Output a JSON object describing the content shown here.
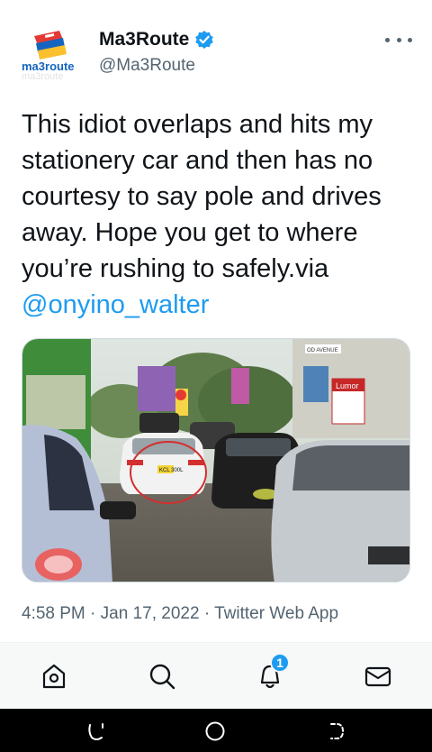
{
  "author": {
    "display_name": "Ma3Route",
    "handle": "@Ma3Route",
    "avatar_text": "ma3route",
    "verified": true
  },
  "tweet": {
    "text": "This idiot overlaps and hits my stationery car and then has no courtesy to say pole and drives away. Hope you get to where you’re rushing to safely.via ",
    "mention": "@onyino_walter",
    "time": "4:58 PM",
    "separator": "·",
    "date": "Jan 17, 2022",
    "source": "Twitter Web App"
  },
  "media": {
    "description_icons": "photo",
    "sign_text": "Lumor",
    "road_sign": "OD AVENUE",
    "plate_text": "KCL 300L"
  },
  "tabbar": {
    "items": [
      {
        "icon": "home-icon"
      },
      {
        "icon": "search-icon"
      },
      {
        "icon": "bell-icon"
      },
      {
        "icon": "mail-icon"
      }
    ],
    "notification_count": "1"
  },
  "colors": {
    "accent": "#1d9bf0",
    "text": "#0f1419",
    "secondary": "#536471"
  }
}
